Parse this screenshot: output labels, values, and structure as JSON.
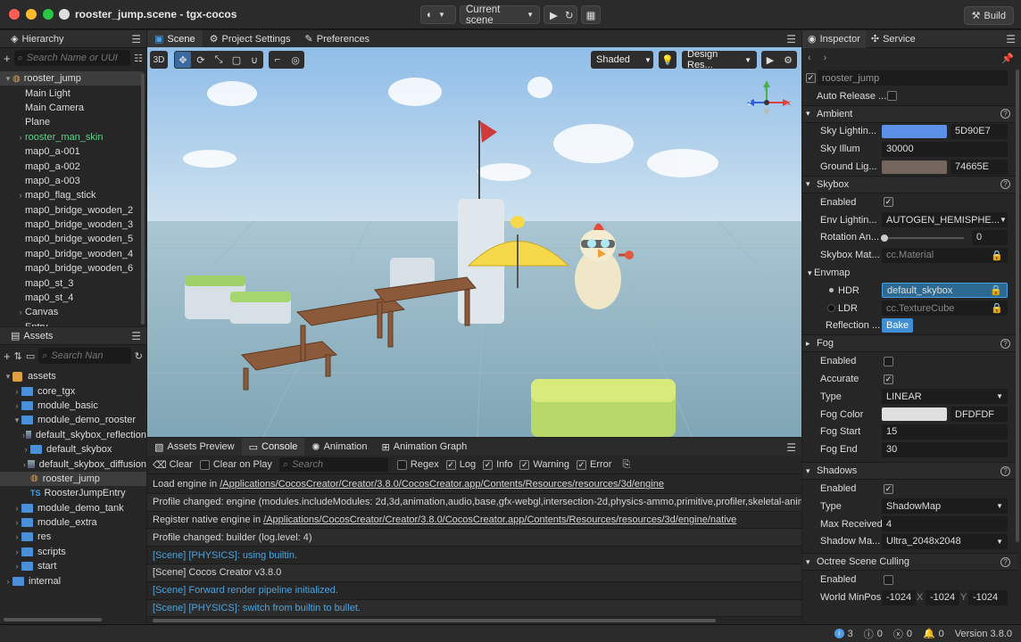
{
  "window": {
    "title": "rooster_jump.scene - tgx-cocos",
    "build_label": "Build",
    "scene_select": "Current scene"
  },
  "hierarchy": {
    "title": "Hierarchy",
    "search_placeholder": "Search Name or UUI",
    "items": [
      {
        "label": "rooster_jump",
        "depth": 0,
        "arrow": "▾",
        "selected": true
      },
      {
        "label": "Main Light",
        "depth": 1,
        "arrow": ""
      },
      {
        "label": "Main Camera",
        "depth": 1,
        "arrow": ""
      },
      {
        "label": "Plane",
        "depth": 1,
        "arrow": ""
      },
      {
        "label": "rooster_man_skin",
        "depth": 1,
        "arrow": "›",
        "color": "#5fcf8a"
      },
      {
        "label": "map0_a-001",
        "depth": 1,
        "arrow": ""
      },
      {
        "label": "map0_a-002",
        "depth": 1,
        "arrow": ""
      },
      {
        "label": "map0_a-003",
        "depth": 1,
        "arrow": ""
      },
      {
        "label": "map0_flag_stick",
        "depth": 1,
        "arrow": "›"
      },
      {
        "label": "map0_bridge_wooden_2",
        "depth": 1,
        "arrow": ""
      },
      {
        "label": "map0_bridge_wooden_3",
        "depth": 1,
        "arrow": ""
      },
      {
        "label": "map0_bridge_wooden_5",
        "depth": 1,
        "arrow": ""
      },
      {
        "label": "map0_bridge_wooden_4",
        "depth": 1,
        "arrow": ""
      },
      {
        "label": "map0_bridge_wooden_6",
        "depth": 1,
        "arrow": ""
      },
      {
        "label": "map0_st_3",
        "depth": 1,
        "arrow": ""
      },
      {
        "label": "map0_st_4",
        "depth": 1,
        "arrow": ""
      },
      {
        "label": "Canvas",
        "depth": 1,
        "arrow": "›"
      },
      {
        "label": "Entry",
        "depth": 1,
        "arrow": ""
      }
    ]
  },
  "assets": {
    "title": "Assets",
    "search_placeholder": "Search Nan",
    "items": [
      {
        "label": "assets",
        "depth": 0,
        "arrow": "▾",
        "icon": "db"
      },
      {
        "label": "core_tgx",
        "depth": 1,
        "arrow": "›",
        "icon": "folder"
      },
      {
        "label": "module_basic",
        "depth": 1,
        "arrow": "›",
        "icon": "folder"
      },
      {
        "label": "module_demo_rooster",
        "depth": 1,
        "arrow": "▾",
        "icon": "folder"
      },
      {
        "label": "default_skybox_reflection",
        "depth": 2,
        "arrow": "›",
        "icon": "tex"
      },
      {
        "label": "default_skybox",
        "depth": 2,
        "arrow": "›",
        "icon": "folder"
      },
      {
        "label": "default_skybox_diffusion",
        "depth": 2,
        "arrow": "›",
        "icon": "tex"
      },
      {
        "label": "rooster_jump",
        "depth": 2,
        "arrow": "",
        "icon": "scene",
        "selected": true
      },
      {
        "label": "RoosterJumpEntry",
        "depth": 2,
        "arrow": "",
        "icon": "ts"
      },
      {
        "label": "module_demo_tank",
        "depth": 1,
        "arrow": "›",
        "icon": "folder"
      },
      {
        "label": "module_extra",
        "depth": 1,
        "arrow": "›",
        "icon": "folder"
      },
      {
        "label": "res",
        "depth": 1,
        "arrow": "›",
        "icon": "folder"
      },
      {
        "label": "scripts",
        "depth": 1,
        "arrow": "›",
        "icon": "folder"
      },
      {
        "label": "start",
        "depth": 1,
        "arrow": "›",
        "icon": "folder"
      },
      {
        "label": "internal",
        "depth": 0,
        "arrow": "›",
        "icon": "folder"
      }
    ]
  },
  "scene_tabs": [
    "Scene",
    "Project Settings",
    "Preferences"
  ],
  "viewport": {
    "mode_3d": "3D",
    "shading": "Shaded",
    "resolution": "Design Res...",
    "gizmo_labels": {
      "y": "y",
      "x": "x",
      "z": "z"
    }
  },
  "bottom_tabs": [
    "Assets Preview",
    "Console",
    "Animation",
    "Animation Graph"
  ],
  "console_toolbar": {
    "clear": "Clear",
    "clear_on_play": "Clear on Play",
    "search_placeholder": "Search",
    "regex": "Regex",
    "log": "Log",
    "info": "Info",
    "warning": "Warning",
    "error": "Error"
  },
  "console_lines": [
    {
      "prefix": "Load engine in ",
      "path": "/Applications/CocosCreator/Creator/3.8.0/CocosCreator.app/Contents/Resources/resources/3d/engine",
      "blue": false
    },
    {
      "prefix": "Profile changed: engine (modules.includeModules: 2d,3d,animation,audio,base,gfx-webgl,intersection-2d,physics-ammo,primitive,profiler,skeletal-animation",
      "path": "",
      "blue": false
    },
    {
      "prefix": "Register native engine in ",
      "path": "/Applications/CocosCreator/Creator/3.8.0/CocosCreator.app/Contents/Resources/resources/3d/engine/native",
      "blue": false
    },
    {
      "prefix": "Profile changed: builder (log.level: 4)",
      "path": "",
      "blue": false
    },
    {
      "prefix": "[Scene] [PHYSICS]: using builtin.",
      "path": "",
      "blue": true
    },
    {
      "prefix": "[Scene] Cocos Creator v3.8.0",
      "path": "",
      "blue": false
    },
    {
      "prefix": "[Scene] Forward render pipeline initialized.",
      "path": "",
      "blue": true
    },
    {
      "prefix": "[Scene] [PHYSICS]: switch from builtin to bullet.",
      "path": "",
      "blue": true
    }
  ],
  "inspector": {
    "tabs": [
      "Inspector",
      "Service"
    ],
    "node_name": "rooster_jump",
    "auto_release": "Auto Release ...",
    "ambient": {
      "title": "Ambient",
      "sky_lighting_label": "Sky Lightin...",
      "sky_lighting_hex": "5D90E7",
      "sky_lighting_color": "#5D90E7",
      "sky_illum_label": "Sky Illum",
      "sky_illum": "30000",
      "ground_label": "Ground Lig...",
      "ground_hex": "74665E",
      "ground_color": "#74665E"
    },
    "skybox": {
      "title": "Skybox",
      "enabled_label": "Enabled",
      "env_label": "Env Lightin...",
      "env_value": "AUTOGEN_HEMISPHE...",
      "rotation_label": "Rotation An...",
      "rotation_value": "0",
      "rotation_fraction": 0,
      "material_label": "Skybox Mat...",
      "material_value": "cc.Material",
      "envmap_label": "Envmap",
      "hdr_label": "HDR",
      "hdr_value": "default_skybox",
      "ldr_label": "LDR",
      "ldr_value": "cc.TextureCube",
      "reflection_label": "Reflection ...",
      "bake_label": "Bake"
    },
    "fog": {
      "title": "Fog",
      "enabled_label": "Enabled",
      "accurate_label": "Accurate",
      "type_label": "Type",
      "type_value": "LINEAR",
      "color_label": "Fog Color",
      "color_hex": "DFDFDF",
      "color": "#DFDFDF",
      "start_label": "Fog Start",
      "start_value": "15",
      "end_label": "Fog End",
      "end_value": "30"
    },
    "shadows": {
      "title": "Shadows",
      "enabled_label": "Enabled",
      "type_label": "Type",
      "type_value": "ShadowMap",
      "max_label": "Max Received",
      "max_value": "4",
      "map_label": "Shadow Ma...",
      "map_value": "Ultra_2048x2048"
    },
    "octree": {
      "title": "Octree Scene Culling",
      "enabled_label": "Enabled",
      "minpos_label": "World MinPos",
      "x": "-1024",
      "y": "-1024",
      "z": "-1024",
      "xl": "X",
      "yl": "Y"
    }
  },
  "status": {
    "info": "3",
    "warn": "0",
    "error": "0",
    "notify": "0",
    "version": "Version 3.8.0"
  }
}
